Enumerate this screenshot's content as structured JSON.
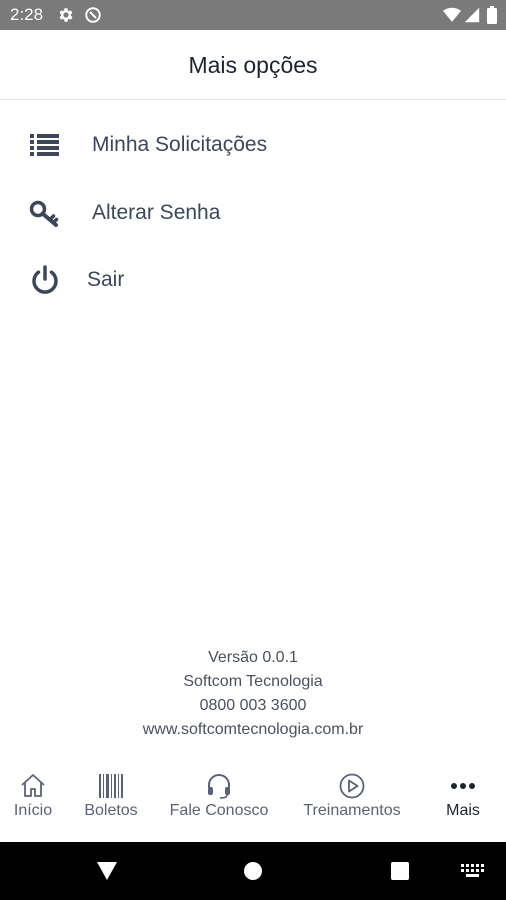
{
  "status_bar": {
    "time": "2:28",
    "icons": [
      "gear-icon",
      "dnd-icon",
      "wifi-icon",
      "signal-icon",
      "battery-icon"
    ],
    "background": "#7a7a7a"
  },
  "header": {
    "title": "Mais opções"
  },
  "menu": {
    "items": [
      {
        "label": "Minha Solicitações",
        "icon": "list-icon"
      },
      {
        "label": "Alterar Senha",
        "icon": "key-icon"
      },
      {
        "label": "Sair",
        "icon": "power-icon"
      }
    ]
  },
  "footer": {
    "version": "Versão 0.0.1",
    "company": "Softcom Tecnologia",
    "phone": "0800 003 3600",
    "website": "www.softcomtecnologia.com.br"
  },
  "bottom_nav": {
    "items": [
      {
        "label": "Início",
        "icon": "home-icon",
        "active": false
      },
      {
        "label": "Boletos",
        "icon": "barcode-icon",
        "active": false
      },
      {
        "label": "Fale Conosco",
        "icon": "headset-icon",
        "active": false
      },
      {
        "label": "Treinamentos",
        "icon": "play-circle-icon",
        "active": false
      },
      {
        "label": "Mais",
        "icon": "more-icon",
        "active": true
      }
    ]
  },
  "colors": {
    "icon": "#3d4759",
    "text": "#1e2330",
    "nav_inactive": "#5c6275"
  }
}
